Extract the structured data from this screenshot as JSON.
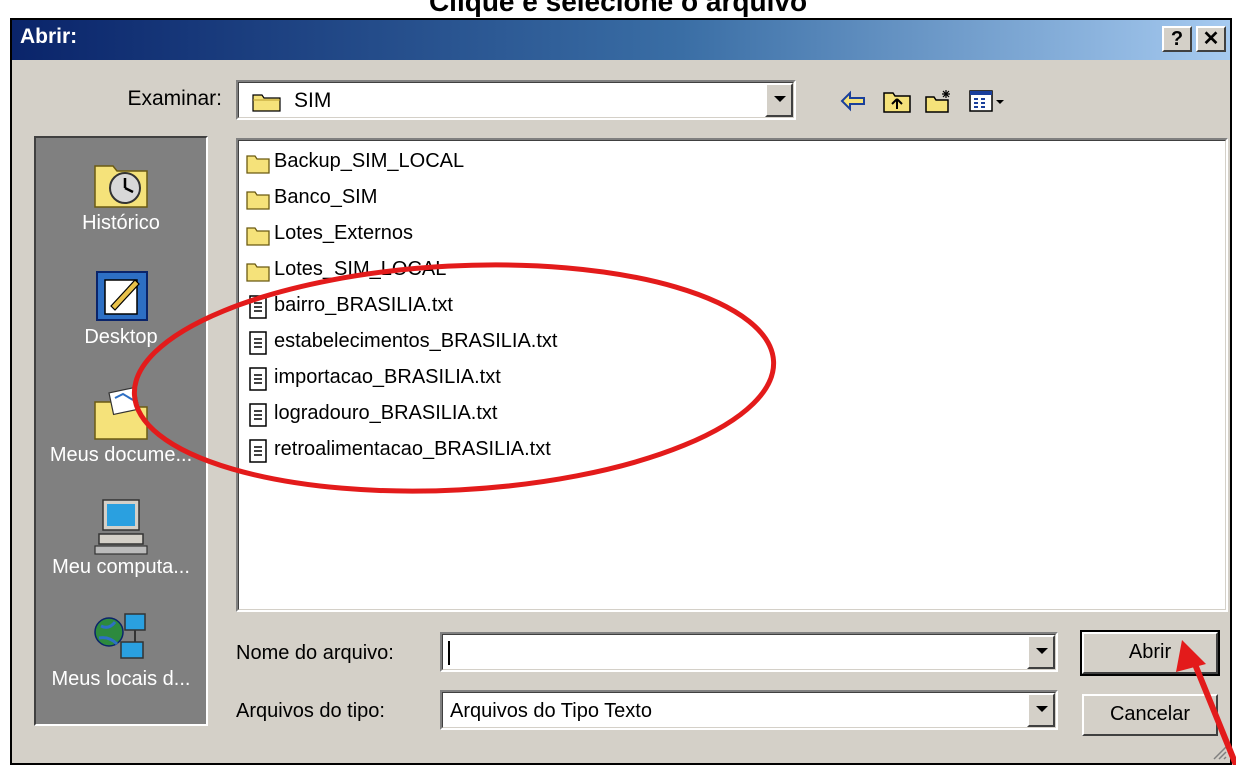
{
  "caption": "Clique e selecione o arquivo",
  "title": "Abrir:",
  "title_buttons": {
    "help": "?",
    "close": "✕"
  },
  "look_in": {
    "label": "Examinar:",
    "value": "SIM"
  },
  "toolbar_icons": [
    "back-arrow-icon",
    "up-folder-icon",
    "new-folder-icon",
    "view-menu-icon"
  ],
  "places": [
    {
      "label": "Histórico",
      "icon": "history-icon"
    },
    {
      "label": "Desktop",
      "icon": "desktop-icon"
    },
    {
      "label": "Meus docume...",
      "icon": "my-documents-icon"
    },
    {
      "label": "Meu computa...",
      "icon": "my-computer-icon"
    },
    {
      "label": "Meus locais d...",
      "icon": "network-places-icon"
    }
  ],
  "files": [
    {
      "name": "Backup_SIM_LOCAL",
      "type": "folder"
    },
    {
      "name": "Banco_SIM",
      "type": "folder"
    },
    {
      "name": "Lotes_Externos",
      "type": "folder"
    },
    {
      "name": "Lotes_SIM_LOCAL",
      "type": "folder"
    },
    {
      "name": "bairro_BRASILIA.txt",
      "type": "text"
    },
    {
      "name": "estabelecimentos_BRASILIA.txt",
      "type": "text"
    },
    {
      "name": "importacao_BRASILIA.txt",
      "type": "text"
    },
    {
      "name": "logradouro_BRASILIA.txt",
      "type": "text"
    },
    {
      "name": "retroalimentacao_BRASILIA.txt",
      "type": "text"
    }
  ],
  "file_name": {
    "label": "Nome do arquivo:",
    "value": ""
  },
  "file_type": {
    "label": "Arquivos do tipo:",
    "value": "Arquivos do Tipo Texto"
  },
  "buttons": {
    "open": "Abrir",
    "cancel": "Cancelar"
  },
  "annotation_color": "#e31b1b"
}
